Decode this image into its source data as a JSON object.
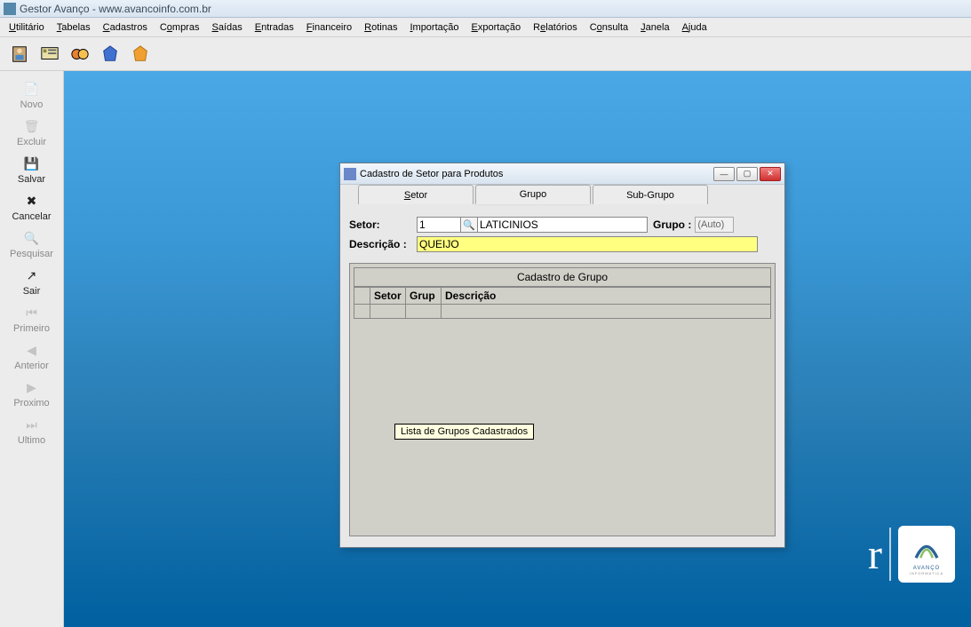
{
  "app": {
    "title": "Gestor Avanço - www.avancoinfo.com.br"
  },
  "menubar": [
    {
      "key": "U",
      "rest": "tilitário"
    },
    {
      "key": "T",
      "rest": "abelas"
    },
    {
      "key": "C",
      "rest": "adastros"
    },
    {
      "key": "C",
      "rest": "o",
      "tail": "mpras"
    },
    {
      "key": "S",
      "rest": "aídas"
    },
    {
      "key": "E",
      "rest": "ntradas"
    },
    {
      "key": "F",
      "rest": "inanceiro"
    },
    {
      "key": "R",
      "rest": "otinas"
    },
    {
      "key": "I",
      "rest": "mportação"
    },
    {
      "key": "E",
      "rest": "xportação"
    },
    {
      "key": "R",
      "rest": "",
      "tail": "elatórios"
    },
    {
      "key": "C",
      "rest": "",
      "tail": "onsulta"
    },
    {
      "key": "J",
      "rest": "anela"
    },
    {
      "key": "A",
      "rest": "juda"
    }
  ],
  "menubar_labels": [
    "Utilitário",
    "Tabelas",
    "Cadastros",
    "Compras",
    "Saídas",
    "Entradas",
    "Financeiro",
    "Rotinas",
    "Importação",
    "Exportação",
    "Relatórios",
    "Consulta",
    "Janela",
    "Ajuda"
  ],
  "menubar_underline": [
    "U",
    "T",
    "C",
    "o",
    "S",
    "E",
    "F",
    "R",
    "I",
    "E",
    "e",
    "o",
    "J",
    "A"
  ],
  "sidebar": [
    {
      "label": "Novo",
      "enabled": false,
      "icon": "📄"
    },
    {
      "label": "Excluir",
      "enabled": false,
      "icon": "🗑"
    },
    {
      "label": "Salvar",
      "enabled": true,
      "icon": "💾"
    },
    {
      "label": "Cancelar",
      "enabled": true,
      "icon": "✖"
    },
    {
      "label": "Pesquisar",
      "enabled": false,
      "icon": "🔍"
    },
    {
      "label": "Sair",
      "enabled": true,
      "icon": "↗"
    },
    {
      "label": "Primeiro",
      "enabled": false,
      "icon": "⏮"
    },
    {
      "label": "Anterior",
      "enabled": false,
      "icon": "◀"
    },
    {
      "label": "Proximo",
      "enabled": false,
      "icon": "▶"
    },
    {
      "label": "Ultimo",
      "enabled": false,
      "icon": "⏭"
    }
  ],
  "child": {
    "title": "Cadastro de Setor para Produtos",
    "tabs": [
      "Setor",
      "Grupo",
      "Sub-Grupo"
    ],
    "active_tab": 1,
    "form": {
      "setor_label": "Setor:",
      "setor_code": "1",
      "setor_name": "LATICINIOS",
      "grupo_label": "Grupo :",
      "grupo_value": "(Auto)",
      "descricao_label": "Descrição :",
      "descricao_value": "QUEIJO"
    },
    "table": {
      "title": "Cadastro de Grupo",
      "columns": [
        "",
        "Setor",
        "Grup",
        "Descrição"
      ]
    },
    "tooltip": "Lista de Grupos Cadastrados"
  },
  "logo": {
    "brand": "AVANÇO",
    "sub": "INFORMATICA"
  }
}
